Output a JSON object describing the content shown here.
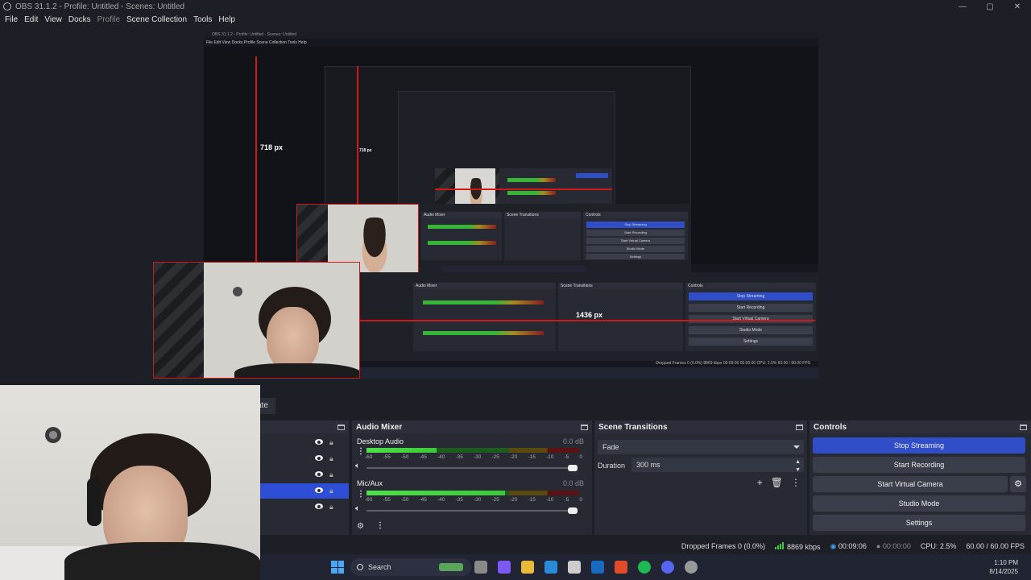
{
  "window": {
    "title": "OBS 31.1.2 - Profile: Untitled - Scenes: Untitled",
    "controls": [
      "—",
      "▢",
      "✕"
    ]
  },
  "menu": [
    "File",
    "Edit",
    "View",
    "Docks",
    "Profile",
    "Scene Collection",
    "Tools",
    "Help"
  ],
  "preview": {
    "nested_title": "OBS 31.1.2 - Profile: Untitled - Scenes: Untitled",
    "nested_menu": "File   Edit   View   Docks   Profile   Scene Collection   Tools   Help",
    "height_label": "718 px",
    "height_label_small": "718 px",
    "width_label": "1436 px",
    "inner_controls": [
      "Stop Streaming",
      "Start Recording",
      "Start Virtual Camera",
      "Studio Mode",
      "Settings"
    ],
    "inner_panels": [
      "Audio Mixer",
      "Scene Transitions",
      "Controls"
    ],
    "inner_status": "Dropped Frames 0 (0.0%)   8869 kbps   00:09:06   00:00:00   CPU: 2.5%   60.00 / 60.00 FPS"
  },
  "dock_tab_label": "ate",
  "sources": {
    "rows": [
      {
        "selected": false
      },
      {
        "selected": false
      },
      {
        "selected": false
      },
      {
        "selected": true
      },
      {
        "selected": false
      }
    ]
  },
  "audio_mixer": {
    "title": "Audio Mixer",
    "ticks": [
      "-60",
      "-55",
      "-50",
      "-45",
      "-40",
      "-35",
      "-30",
      "-25",
      "-20",
      "-15",
      "-10",
      "-5",
      "0"
    ],
    "channels": [
      {
        "name": "Desktop Audio",
        "db": "0.0 dB",
        "level": 0.33
      },
      {
        "name": "Mic/Aux",
        "db": "0.0 dB",
        "level": 0.65
      }
    ]
  },
  "scene_transitions": {
    "title": "Scene Transitions",
    "transition": "Fade",
    "duration_label": "Duration",
    "duration_value": "300 ms"
  },
  "controls": {
    "title": "Controls",
    "stop_streaming": "Stop Streaming",
    "start_recording": "Start Recording",
    "start_virtual_camera": "Start Virtual Camera",
    "studio_mode": "Studio Mode",
    "settings": "Settings"
  },
  "status": {
    "dropped_frames": "Dropped Frames 0 (0.0%)",
    "bitrate": "8869 kbps",
    "stream_time": "00:09:06",
    "record_time": "00:00:00",
    "cpu": "CPU: 2.5%",
    "fps": "60.00 / 60.00 FPS"
  },
  "taskbar": {
    "search_placeholder": "Search",
    "time": "1:10 PM",
    "date": "8/14/2025",
    "icon_colors": [
      "#5aa55a",
      "#8a8a8a",
      "#7a5af0",
      "#e8b93a",
      "#2a8ad6",
      "#cccccc",
      "#1a6ac0",
      "#e04b2a",
      "#1db954",
      "#5865f2",
      "#999999"
    ]
  }
}
